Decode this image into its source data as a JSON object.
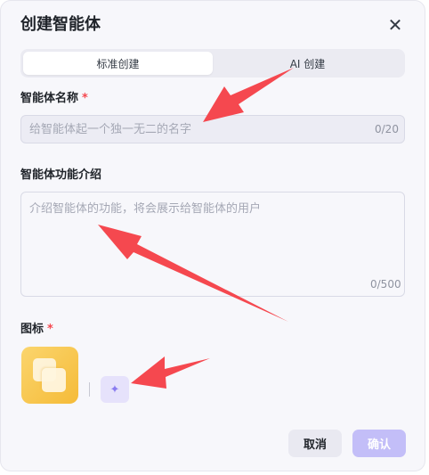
{
  "dialog": {
    "title": "创建智能体",
    "close_glyph": "✕"
  },
  "tabs": [
    {
      "label": "标准创建",
      "active": true
    },
    {
      "label": "AI 创建",
      "active": false
    }
  ],
  "name_field": {
    "label": "智能体名称",
    "required_mark": "*",
    "placeholder": "给智能体起一个独一无二的名字",
    "value": "",
    "counter": "0/20"
  },
  "description_field": {
    "label": "智能体功能介绍",
    "placeholder": "介绍智能体的功能，将会展示给智能体的用户",
    "value": "",
    "counter": "0/500"
  },
  "icon_section": {
    "label": "图标",
    "required_mark": "*",
    "tile_color": "#f7c64a",
    "ai_button_icon": "sparkle-icon",
    "ai_button_glyph": "✦"
  },
  "footer": {
    "cancel_label": "取消",
    "confirm_label": "确认",
    "confirm_color": "#c3bef8"
  },
  "annotation": {
    "arrow_color": "#f5484f"
  }
}
